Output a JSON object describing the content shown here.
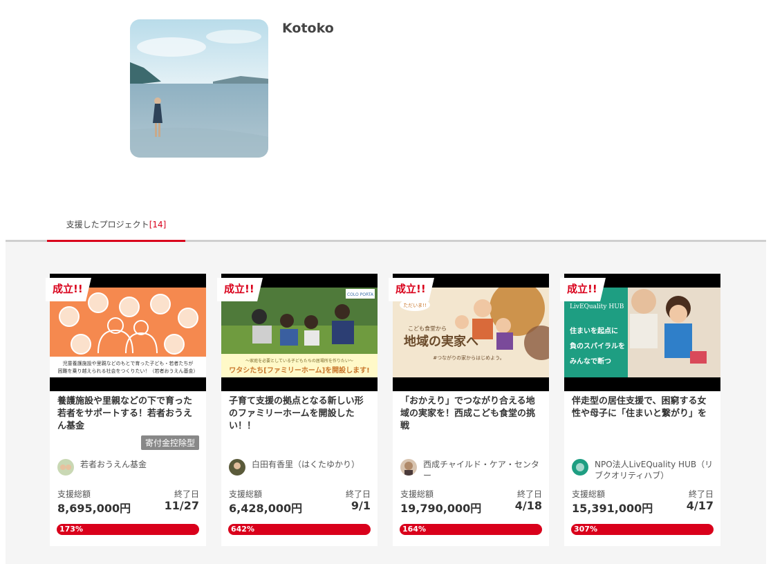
{
  "profile": {
    "name": "Kotoko"
  },
  "tabs": {
    "supported_label": "支援したプロジェクト",
    "supported_count": "[14]"
  },
  "labels": {
    "total_label": "支援総額",
    "end_label": "終了日",
    "success_badge": "成立!!"
  },
  "colors": {
    "accent": "#d9001b",
    "badge_gray": "#888888",
    "gallery_bg": "#f5f5f5"
  },
  "projects": [
    {
      "title": "養護施設や里親などの下で育った若者をサポートする！若者おうえん基金",
      "tax_badge": "寄付金控除型",
      "owner": "若者おうえん基金",
      "total": "8,695,000円",
      "end_date": "11/27",
      "progress": "173%",
      "thumb_caption_1": "児童養護施設や里親などのもとで育った子ども・若者たちが",
      "thumb_caption_2": "困難を乗り越えられる社会をつくりたい！（若者おうえん基金）"
    },
    {
      "title": "子育て支援の拠点となる新しい形のファミリーホームを開設したい！！",
      "owner": "白田有香里（はくたゆかり）",
      "total": "6,428,000円",
      "end_date": "9/1",
      "progress": "642%",
      "thumb_caption_1": "〜家庭を必要としている子どもたちの居場所を作りたい〜",
      "thumb_caption_2": "ワタシたち[ファミリーホーム]を開設します!",
      "thumb_logo": "COLO PORTA"
    },
    {
      "title": "「おかえり」でつながり合える地域の実家を！西成こども食堂の挑戦",
      "owner": "西成チャイルド・ケア・センター",
      "total": "19,790,000円",
      "end_date": "4/18",
      "progress": "164%",
      "thumb_caption_1": "こども食堂から",
      "thumb_caption_2": "地域の実家へ",
      "thumb_caption_3": "#つながりの家からはじめよう。",
      "thumb_bubble": "ただいま!!"
    },
    {
      "title": "伴走型の居住支援で、困窮する女性や母子に「住まいと繋がり」を",
      "owner": "NPO法人LivEQuality HUB（リブクオリティハブ）",
      "total": "15,391,000円",
      "end_date": "4/17",
      "progress": "307%",
      "thumb_logo": "LivEQuality HUB",
      "thumb_caption_1": "住まいを起点に",
      "thumb_caption_2": "負のスパイラルを",
      "thumb_caption_3": "みんなで断つ"
    }
  ]
}
